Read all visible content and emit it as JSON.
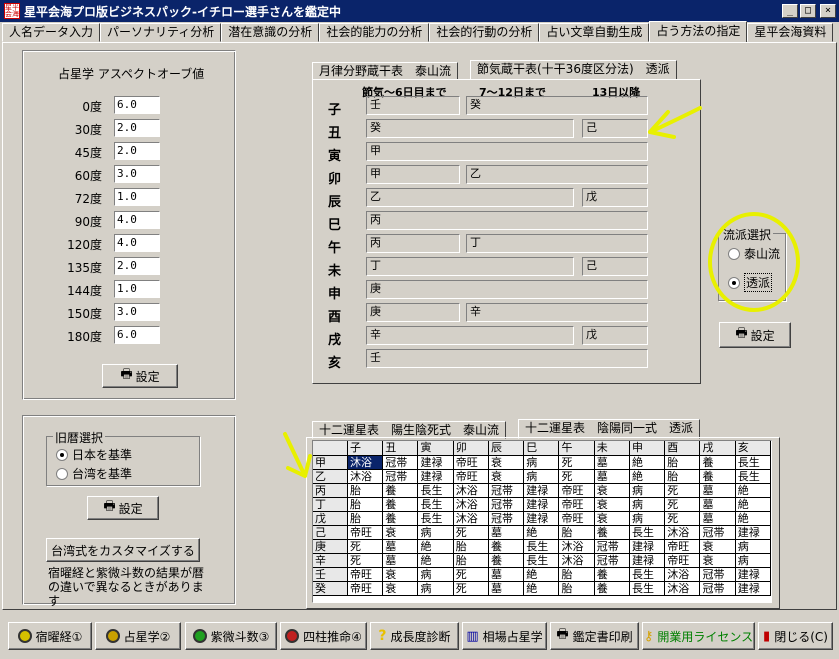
{
  "window": {
    "title": "星平会海プロ版ビジネスパック-イチロー選手さんを鑑定中",
    "icon_text": "星平会海"
  },
  "tabs": [
    "人名データ入力",
    "パーソナリティ分析",
    "潜在意識の分析",
    "社会的能力の分析",
    "社会的行動の分析",
    "占い文章自動生成",
    "占う方法の指定",
    "星平会海資料"
  ],
  "aspect": {
    "title": "占星学 アスペクトオーブ値",
    "rows": [
      {
        "label": "0度",
        "value": "6.0"
      },
      {
        "label": "30度",
        "value": "2.0"
      },
      {
        "label": "45度",
        "value": "2.0"
      },
      {
        "label": "60度",
        "value": "3.0"
      },
      {
        "label": "72度",
        "value": "1.0"
      },
      {
        "label": "90度",
        "value": "4.0"
      },
      {
        "label": "120度",
        "value": "4.0"
      },
      {
        "label": "135度",
        "value": "2.0"
      },
      {
        "label": "144度",
        "value": "1.0"
      },
      {
        "label": "150度",
        "value": "3.0"
      },
      {
        "label": "180度",
        "value": "6.0"
      }
    ],
    "set_label": "設定"
  },
  "calendar": {
    "title": "旧暦選択",
    "options": [
      "日本を基準",
      "台湾を基準"
    ],
    "set_label": "設定",
    "customize_label": "台湾式をカスタマイズする",
    "note": "宿曜経と紫微斗数の結果が暦の違いで異なるときがあります"
  },
  "zokan": {
    "tabs": [
      "月律分野蔵干表　泰山流",
      "節気蔵干表(十干36度区分法)　透派"
    ],
    "headers": [
      "節気～6日目まで",
      "7～12日まで",
      "13日以降"
    ],
    "rows": [
      {
        "branch": "子",
        "c1": "壬",
        "c2": "癸",
        "c3": ""
      },
      {
        "branch": "丑",
        "c1": "癸",
        "c2": "",
        "c3": "己"
      },
      {
        "branch": "寅",
        "c1": "甲",
        "c2": "",
        "c3": ""
      },
      {
        "branch": "卯",
        "c1": "甲",
        "c2": "乙",
        "c3": ""
      },
      {
        "branch": "辰",
        "c1": "乙",
        "c2": "",
        "c3": "戊"
      },
      {
        "branch": "巳",
        "c1": "丙",
        "c2": "",
        "c3": ""
      },
      {
        "branch": "午",
        "c1": "丙",
        "c2": "丁",
        "c3": ""
      },
      {
        "branch": "未",
        "c1": "丁",
        "c2": "",
        "c3": "己"
      },
      {
        "branch": "申",
        "c1": "庚",
        "c2": "",
        "c3": ""
      },
      {
        "branch": "酉",
        "c1": "庚",
        "c2": "辛",
        "c3": ""
      },
      {
        "branch": "戌",
        "c1": "辛",
        "c2": "",
        "c3": "戊"
      },
      {
        "branch": "亥",
        "c1": "壬",
        "c2": "",
        "c3": ""
      }
    ]
  },
  "school": {
    "title": "流派選択",
    "options": [
      "泰山流",
      "透派"
    ],
    "set_label": "設定"
  },
  "twelve": {
    "tabs": [
      "十二運星表　陽生陰死式　泰山流",
      "十二運星表　陰陽同一式　透派"
    ],
    "col_headers": [
      "子",
      "丑",
      "寅",
      "卯",
      "辰",
      "巳",
      "午",
      "未",
      "申",
      "酉",
      "戌",
      "亥"
    ],
    "rows": [
      {
        "stem": "甲",
        "cells": [
          "沐浴",
          "冠帯",
          "建禄",
          "帝旺",
          "衰",
          "病",
          "死",
          "墓",
          "絶",
          "胎",
          "養",
          "長生"
        ]
      },
      {
        "stem": "乙",
        "cells": [
          "沐浴",
          "冠帯",
          "建禄",
          "帝旺",
          "衰",
          "病",
          "死",
          "墓",
          "絶",
          "胎",
          "養",
          "長生"
        ]
      },
      {
        "stem": "丙",
        "cells": [
          "胎",
          "養",
          "長生",
          "沐浴",
          "冠帯",
          "建禄",
          "帝旺",
          "衰",
          "病",
          "死",
          "墓",
          "絶"
        ]
      },
      {
        "stem": "丁",
        "cells": [
          "胎",
          "養",
          "長生",
          "沐浴",
          "冠帯",
          "建禄",
          "帝旺",
          "衰",
          "病",
          "死",
          "墓",
          "絶"
        ]
      },
      {
        "stem": "戊",
        "cells": [
          "胎",
          "養",
          "長生",
          "沐浴",
          "冠帯",
          "建禄",
          "帝旺",
          "衰",
          "病",
          "死",
          "墓",
          "絶"
        ]
      },
      {
        "stem": "己",
        "cells": [
          "帝旺",
          "衰",
          "病",
          "死",
          "墓",
          "絶",
          "胎",
          "養",
          "長生",
          "沐浴",
          "冠帯",
          "建禄"
        ]
      },
      {
        "stem": "庚",
        "cells": [
          "死",
          "墓",
          "絶",
          "胎",
          "養",
          "長生",
          "沐浴",
          "冠帯",
          "建禄",
          "帝旺",
          "衰",
          "病"
        ]
      },
      {
        "stem": "辛",
        "cells": [
          "死",
          "墓",
          "絶",
          "胎",
          "養",
          "長生",
          "沐浴",
          "冠帯",
          "建禄",
          "帝旺",
          "衰",
          "病"
        ]
      },
      {
        "stem": "壬",
        "cells": [
          "帝旺",
          "衰",
          "病",
          "死",
          "墓",
          "絶",
          "胎",
          "養",
          "長生",
          "沐浴",
          "冠帯",
          "建禄"
        ]
      },
      {
        "stem": "癸",
        "cells": [
          "帝旺",
          "衰",
          "病",
          "死",
          "墓",
          "絶",
          "胎",
          "養",
          "長生",
          "沐浴",
          "冠帯",
          "建禄"
        ]
      }
    ]
  },
  "bottom": [
    {
      "label": "宿曜経①",
      "icon": "yellow-circle-icon",
      "color": "#d4c000"
    },
    {
      "label": "占星学②",
      "icon": "yellow-circle-icon",
      "color": "#c8a000"
    },
    {
      "label": "紫微斗数③",
      "icon": "green-circle-icon",
      "color": "#20a020"
    },
    {
      "label": "四柱推命④",
      "icon": "red-circle-icon",
      "color": "#c02020"
    },
    {
      "label": "成長度診断",
      "icon": "question-icon",
      "color": "#c00000"
    },
    {
      "label": "相場占星学",
      "icon": "chart-icon",
      "color": "#0000a0"
    },
    {
      "label": "鑑定書印刷",
      "icon": "printer-icon",
      "color": "#404040"
    },
    {
      "label": "開業用ライセンス",
      "icon": "key-icon",
      "color": "#008000"
    },
    {
      "label": "閉じる(C)",
      "icon": "door-icon",
      "color": "#c00000"
    }
  ]
}
